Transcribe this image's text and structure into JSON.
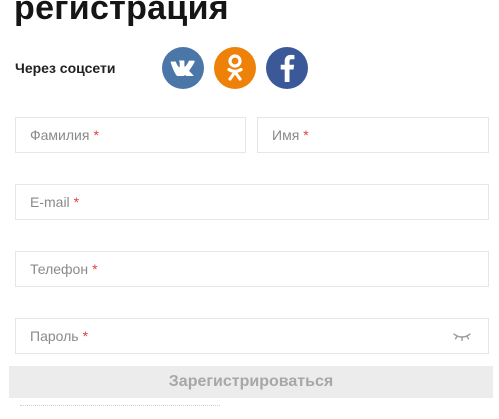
{
  "page": {
    "title": "регистрация"
  },
  "social": {
    "label": "Через соцсети",
    "buttons": [
      {
        "icon": "vk-icon",
        "color": "#4a76a8"
      },
      {
        "icon": "odnoklassniki-icon",
        "color": "#ee8208"
      },
      {
        "icon": "facebook-icon",
        "color": "#3b5998"
      }
    ]
  },
  "form": {
    "last_name": {
      "placeholder": "Фамилия",
      "required_mark": "*",
      "value": ""
    },
    "first_name": {
      "placeholder": "Имя",
      "required_mark": "*",
      "value": ""
    },
    "email": {
      "placeholder": "E-mail",
      "required_mark": "*",
      "value": ""
    },
    "phone": {
      "placeholder": "Телефон",
      "required_mark": "*",
      "value": ""
    },
    "password": {
      "placeholder": "Пароль",
      "required_mark": "*",
      "value": "",
      "toggle_icon": "eye-closed-icon"
    },
    "submit_label": "Зарегистрироваться"
  },
  "colors": {
    "required": "#e0403d",
    "submit_bg": "#ececec",
    "submit_text": "#a7a7a7",
    "field_border": "#e6e6e6"
  }
}
